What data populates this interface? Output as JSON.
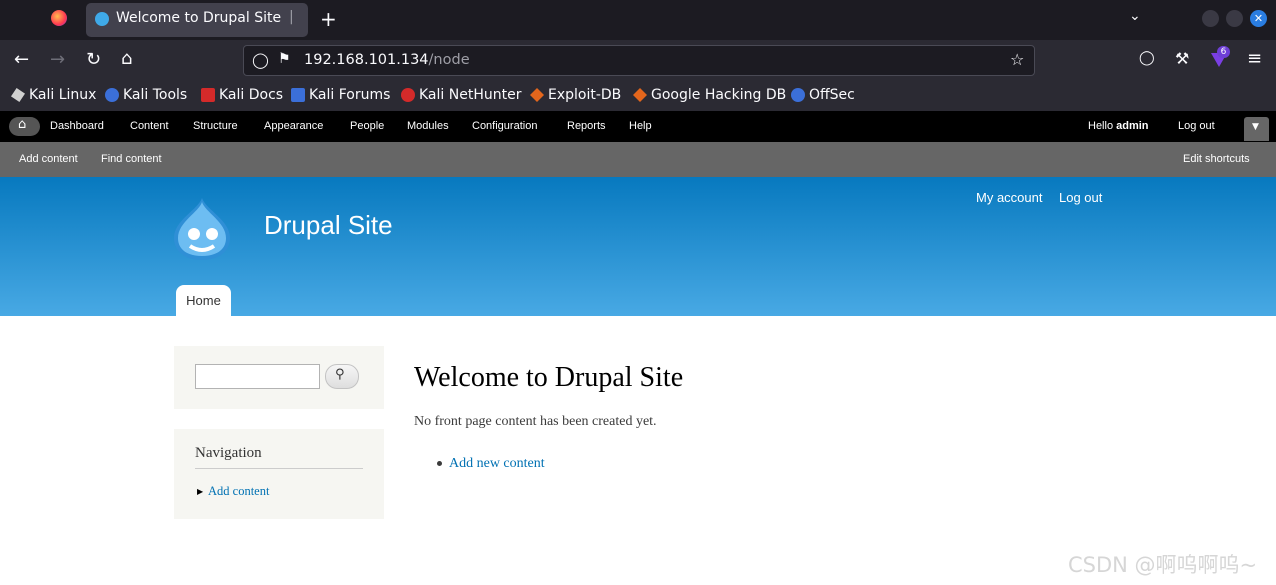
{
  "browser": {
    "tab_title": "Welcome to Drupal Site | D",
    "url_host": "192.168.101.134",
    "url_path": "/node",
    "extensions_badge": "6",
    "bookmarks": [
      {
        "label": "Kali Linux",
        "color": "#d0d0d0"
      },
      {
        "label": "Kali Tools",
        "color": "#3b6fd9"
      },
      {
        "label": "Kali Docs",
        "color": "#d42a2a"
      },
      {
        "label": "Kali Forums",
        "color": "#3b6fd9"
      },
      {
        "label": "Kali NetHunter",
        "color": "#d42a2a"
      },
      {
        "label": "Exploit-DB",
        "color": "#e4661c"
      },
      {
        "label": "Google Hacking DB",
        "color": "#e4661c"
      },
      {
        "label": "OffSec",
        "color": "#3b6fd9"
      }
    ]
  },
  "toolbar": {
    "items": [
      "Dashboard",
      "Content",
      "Structure",
      "Appearance",
      "People",
      "Modules",
      "Configuration",
      "Reports",
      "Help"
    ],
    "hello": "Hello ",
    "user": "admin",
    "logout": "Log out"
  },
  "shortcuts": {
    "items": [
      "Add content",
      "Find content"
    ],
    "edit": "Edit shortcuts"
  },
  "header": {
    "site_name": "Drupal Site",
    "secondary_menu": [
      "My account",
      "Log out"
    ],
    "tab_home": "Home"
  },
  "sidebar": {
    "navigation_title": "Navigation",
    "nav_items": [
      "Add content"
    ]
  },
  "main": {
    "title": "Welcome to Drupal Site",
    "text": "No front page content has been created yet.",
    "links": [
      "Add new content"
    ]
  },
  "watermark": "CSDN @啊呜啊呜~",
  "colors": {
    "header_top": "#0779bf",
    "header_bottom": "#48a9e4",
    "link": "#0071b3",
    "sidebar_bg": "#f6f6f2"
  }
}
